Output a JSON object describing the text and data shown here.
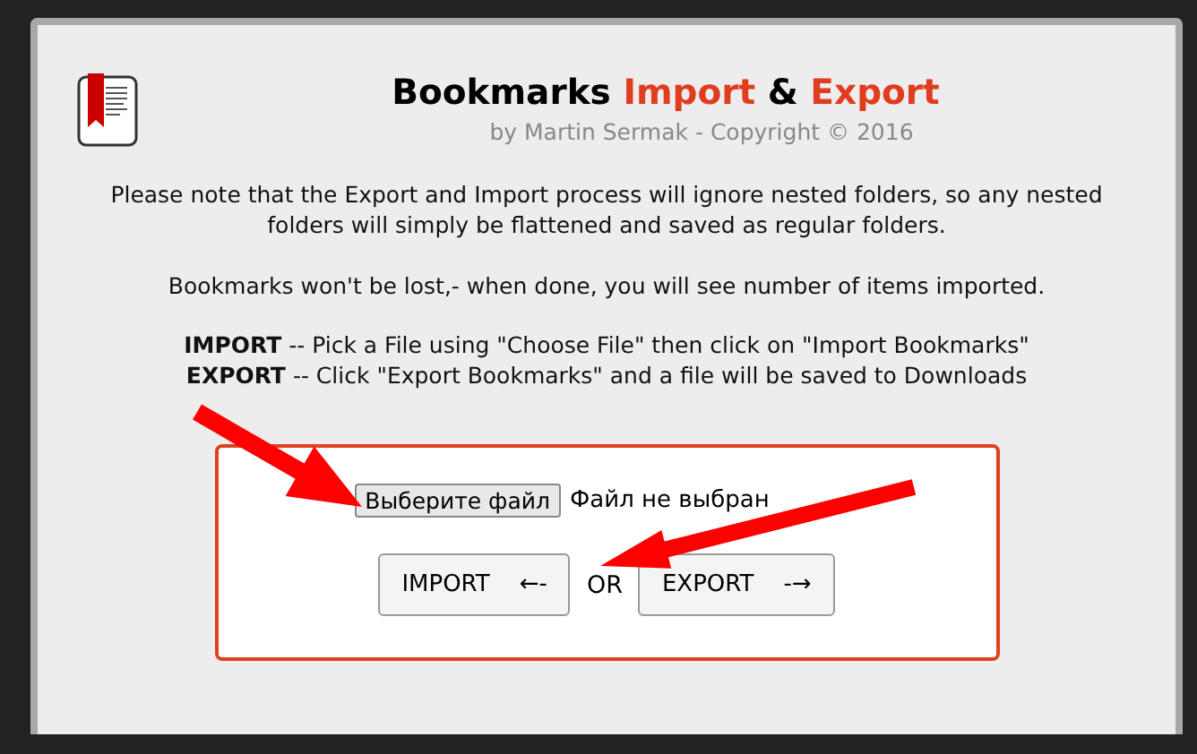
{
  "title": [
    {
      "text": "Bookmarks",
      "kind": "plain"
    },
    {
      "text": "Import",
      "kind": "accent"
    },
    {
      "text": "&",
      "kind": "plain"
    },
    {
      "text": "Export",
      "kind": "accent"
    }
  ],
  "subtitle": "by Martin Sermak - Copyright © 2016",
  "paragraphs": [
    "Please note that the Export and Import process will ignore nested folders, so any nested folders will simply be flattened and saved as regular folders.",
    "Bookmarks won't be lost,- when done, you will see number of items imported."
  ],
  "instructions": [
    "**IMPORT** -- Pick a File using \"Choose File\" then click on \"Import Bookmarks\"",
    "**EXPORT** -- Click \"Export Bookmarks\" and a file will be saved to Downloads"
  ],
  "file_input": {
    "button": "Выберите файл",
    "status": "Файл не выбран"
  },
  "actions": [
    {
      "label": "IMPORT",
      "arrow": "←-"
    },
    {
      "label": "EXPORT",
      "arrow": "-→"
    }
  ],
  "separator": "OR"
}
